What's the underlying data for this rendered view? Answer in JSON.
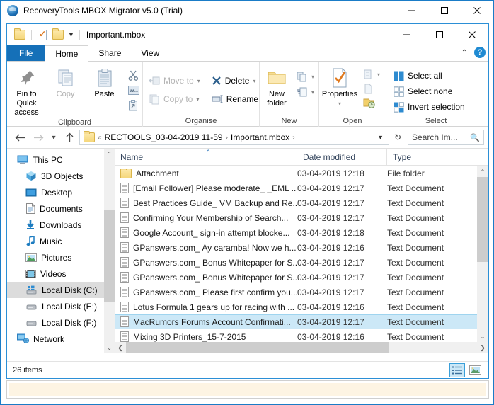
{
  "app": {
    "title": "RecoveryTools MBOX Migrator v5.0 (Trial)",
    "icon": "app-circle-icon",
    "window_controls": {
      "minimize": "minimize-icon",
      "maximize": "maximize-icon",
      "close": "close-icon"
    }
  },
  "explorer": {
    "quick_access": {
      "path_label": "Important.mbox",
      "buttons": [
        "folder-icon",
        "properties-icon",
        "new-folder-icon"
      ],
      "dropdown": "chevron-down-icon",
      "window_controls": {
        "minimize": "minimize-icon",
        "maximize": "maximize-icon",
        "close": "close-icon"
      }
    },
    "ribbon": {
      "tabs": [
        {
          "label": "File",
          "active": false,
          "type": "file"
        },
        {
          "label": "Home",
          "active": true,
          "type": "normal"
        },
        {
          "label": "Share",
          "active": false,
          "type": "normal"
        },
        {
          "label": "View",
          "active": false,
          "type": "normal"
        }
      ],
      "collapse_icon": "chevron-up-icon",
      "help_label": "?",
      "groups": [
        {
          "title": "Clipboard",
          "big_buttons": [
            {
              "label": "Pin to Quick access",
              "icon": "pin-icon",
              "disabled": false
            },
            {
              "label": "Copy",
              "icon": "copy-icon",
              "disabled": true
            },
            {
              "label": "Paste",
              "icon": "paste-icon",
              "disabled": false
            }
          ],
          "small_buttons": [
            {
              "label": "",
              "icon": "cut-icon",
              "disabled": false
            },
            {
              "label": "",
              "icon": "copy-path-icon",
              "disabled": false
            },
            {
              "label": "",
              "icon": "paste-shortcut-icon",
              "disabled": false
            }
          ]
        },
        {
          "title": "Organise",
          "small_buttons": [
            {
              "label": "Move to",
              "icon": "move-to-icon",
              "disabled": true,
              "caret": true
            },
            {
              "label": "Copy to",
              "icon": "copy-to-icon",
              "disabled": true,
              "caret": true
            },
            {
              "label": "Delete",
              "icon": "delete-x-icon",
              "disabled": false,
              "caret": true
            },
            {
              "label": "Rename",
              "icon": "rename-icon",
              "disabled": false,
              "caret": false
            }
          ]
        },
        {
          "title": "New",
          "big_buttons": [
            {
              "label": "New folder",
              "icon": "new-folder-icon",
              "disabled": false
            }
          ],
          "small_buttons": [
            {
              "label": "",
              "icon": "new-item-icon",
              "disabled": false,
              "caret": true
            },
            {
              "label": "",
              "icon": "easy-access-icon",
              "disabled": false,
              "caret": true
            }
          ]
        },
        {
          "title": "Open",
          "big_buttons": [
            {
              "label": "Properties",
              "icon": "properties-icon",
              "disabled": false,
              "caret": true
            }
          ],
          "small_buttons": [
            {
              "label": "",
              "icon": "open-icon",
              "disabled": true,
              "caret": true
            },
            {
              "label": "",
              "icon": "edit-icon",
              "disabled": true
            },
            {
              "label": "",
              "icon": "history-icon",
              "disabled": false
            }
          ]
        },
        {
          "title": "Select",
          "small_buttons": [
            {
              "label": "Select all",
              "icon": "select-all-icon",
              "disabled": false
            },
            {
              "label": "Select none",
              "icon": "select-none-icon",
              "disabled": false
            },
            {
              "label": "Invert selection",
              "icon": "invert-selection-icon",
              "disabled": false
            }
          ]
        }
      ]
    },
    "address_bar": {
      "back_icon": "arrow-left-icon",
      "forward_icon": "arrow-right-icon",
      "recent_icon": "chevron-down-icon",
      "up_icon": "arrow-up-icon",
      "overflow": "«",
      "breadcrumbs": [
        "RECTOOLS_03-04-2019 11-59",
        "Important.mbox"
      ],
      "dropdown_icon": "chevron-down-icon",
      "refresh_icon": "refresh-icon",
      "search_placeholder": "Search Im...",
      "search_value": "",
      "search_icon": "search-icon"
    },
    "nav_pane": {
      "items": [
        {
          "label": "This PC",
          "icon": "this-pc-icon",
          "indent": 0,
          "selected": false
        },
        {
          "label": "3D Objects",
          "icon": "3d-objects-icon",
          "indent": 1,
          "selected": false
        },
        {
          "label": "Desktop",
          "icon": "desktop-icon",
          "indent": 1,
          "selected": false
        },
        {
          "label": "Documents",
          "icon": "documents-icon",
          "indent": 1,
          "selected": false
        },
        {
          "label": "Downloads",
          "icon": "downloads-icon",
          "indent": 1,
          "selected": false
        },
        {
          "label": "Music",
          "icon": "music-icon",
          "indent": 1,
          "selected": false
        },
        {
          "label": "Pictures",
          "icon": "pictures-icon",
          "indent": 1,
          "selected": false
        },
        {
          "label": "Videos",
          "icon": "videos-icon",
          "indent": 1,
          "selected": false
        },
        {
          "label": "Local Disk (C:)",
          "icon": "local-disk-c-icon",
          "indent": 1,
          "selected": true
        },
        {
          "label": "Local Disk (E:)",
          "icon": "local-disk-icon",
          "indent": 1,
          "selected": false
        },
        {
          "label": "Local Disk (F:)",
          "icon": "local-disk-icon",
          "indent": 1,
          "selected": false
        },
        {
          "label": "Network",
          "icon": "network-icon",
          "indent": 0,
          "selected": false
        }
      ],
      "scroll_up_icon": "chevron-up-icon",
      "scroll_down_icon": "chevron-down-icon"
    },
    "file_list": {
      "columns": [
        {
          "label": "Name",
          "sorted": true,
          "sort_icon": "sort-asc-icon"
        },
        {
          "label": "Date modified",
          "sorted": false
        },
        {
          "label": "Type",
          "sorted": false
        }
      ],
      "rows": [
        {
          "name": "Attachment",
          "date": "03-04-2019 12:18",
          "type": "File folder",
          "icon": "folder-icon",
          "selected": false
        },
        {
          "name": "[Email Follower] Please moderate_ _EML ...",
          "date": "03-04-2019 12:17",
          "type": "Text Document",
          "icon": "text-document-icon",
          "selected": false
        },
        {
          "name": "Best Practices Guide_ VM Backup and Re...",
          "date": "03-04-2019 12:17",
          "type": "Text Document",
          "icon": "text-document-icon",
          "selected": false
        },
        {
          "name": "Confirming Your Membership of Search...",
          "date": "03-04-2019 12:17",
          "type": "Text Document",
          "icon": "text-document-icon",
          "selected": false
        },
        {
          "name": "Google Account_ sign-in attempt blocke...",
          "date": "03-04-2019 12:18",
          "type": "Text Document",
          "icon": "text-document-icon",
          "selected": false
        },
        {
          "name": "GPanswers.com_ Ay caramba! Now we h...",
          "date": "03-04-2019 12:16",
          "type": "Text Document",
          "icon": "text-document-icon",
          "selected": false
        },
        {
          "name": "GPanswers.com_ Bonus Whitepaper for S...",
          "date": "03-04-2019 12:17",
          "type": "Text Document",
          "icon": "text-document-icon",
          "selected": false
        },
        {
          "name": "GPanswers.com_ Bonus Whitepaper for S...",
          "date": "03-04-2019 12:17",
          "type": "Text Document",
          "icon": "text-document-icon",
          "selected": false
        },
        {
          "name": "GPanswers.com_ Please first confirm you...",
          "date": "03-04-2019 12:17",
          "type": "Text Document",
          "icon": "text-document-icon",
          "selected": false
        },
        {
          "name": "Lotus Formula 1 gears up for racing with ...",
          "date": "03-04-2019 12:16",
          "type": "Text Document",
          "icon": "text-document-icon",
          "selected": false
        },
        {
          "name": "MacRumors Forums Account Confirmati...",
          "date": "03-04-2019 12:17",
          "type": "Text Document",
          "icon": "text-document-icon",
          "selected": true
        },
        {
          "name": "Mixing 3D Printers_15-7-2015",
          "date": "03-04-2019 12:16",
          "type": "Text Document",
          "icon": "text-document-icon",
          "selected": false
        }
      ],
      "scroll_up_icon": "chevron-up-icon",
      "scroll_down_icon": "chevron-down-icon",
      "hscroll_left_icon": "chevron-left-icon",
      "hscroll_right_icon": "chevron-right-icon"
    },
    "status_bar": {
      "item_count": "26 items",
      "view_buttons": [
        {
          "icon": "details-view-icon",
          "active": true
        },
        {
          "icon": "large-icons-view-icon",
          "active": false
        }
      ]
    }
  },
  "colors": {
    "accent": "#1570b8",
    "window_border": "#1a7cc7",
    "explorer_border": "#2b8fd6",
    "selection": "#cce8f7",
    "nav_selection": "#dcdcdc",
    "strip": "#fdf4e3"
  }
}
